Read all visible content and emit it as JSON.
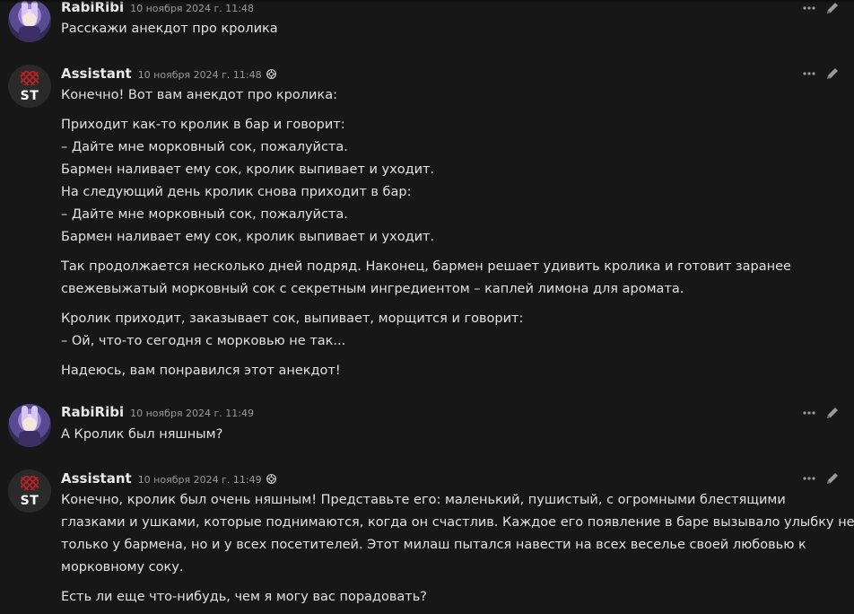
{
  "messages": [
    {
      "author": "RabiRibi",
      "time": "10 ноября 2024 г. 11:48",
      "role": "user",
      "paragraphs": [
        [
          "Расскажи анекдот про кролика"
        ]
      ]
    },
    {
      "author": "Assistant",
      "time": "10 ноября 2024 г. 11:48",
      "role": "assistant",
      "avatar_text": "ST",
      "paragraphs": [
        [
          "Конечно! Вот вам анекдот про кролика:"
        ],
        [
          "Приходит как-то кролик в бар и говорит:",
          "– Дайте мне морковный сок, пожалуйста.",
          "Бармен наливает ему сок, кролик выпивает и уходит.",
          "На следующий день кролик снова приходит в бар:",
          "– Дайте мне морковный сок, пожалуйста.",
          "Бармен наливает ему сок, кролик выпивает и уходит."
        ],
        [
          "Так продолжается несколько дней подряд. Наконец, бармен решает удивить кролика и готовит заранее",
          "свежевыжатый морковный сок с секретным ингредиентом – каплей лимона для аромата."
        ],
        [
          "Кролик приходит, заказывает сок, выпивает, морщится и говорит:",
          "– Ой, что-то сегодня с морковью не так..."
        ],
        [
          "Надеюсь, вам понравился этот анекдот!"
        ]
      ]
    },
    {
      "author": "RabiRibi",
      "time": "10 ноября 2024 г. 11:49",
      "role": "user",
      "paragraphs": [
        [
          "А Кролик был няшным?"
        ]
      ]
    },
    {
      "author": "Assistant",
      "time": "10 ноября 2024 г. 11:49",
      "role": "assistant",
      "avatar_text": "ST",
      "paragraphs": [
        [
          "Конечно, кролик был очень няшным! Представьте его: маленький, пушистый, с огромными блестящими",
          "глазками и ушками, которые поднимаются, когда он счастлив. Каждое его появление в баре вызывало улыбку не",
          "только у бармена, но и у всех посетителей. Этот милаш пытался навести на всех веселье своей любовью к",
          "морковному соку."
        ],
        [
          "Есть ли еще что-нибудь, чем я могу вас порадовать?"
        ]
      ]
    }
  ],
  "icons": {
    "more": "more-dots-icon",
    "edit": "pencil-icon",
    "model": "openai-model-icon"
  },
  "colors": {
    "background": "#171717",
    "text": "#e2e2e2",
    "muted": "#9a9a9a",
    "brand_red": "#b32222"
  }
}
